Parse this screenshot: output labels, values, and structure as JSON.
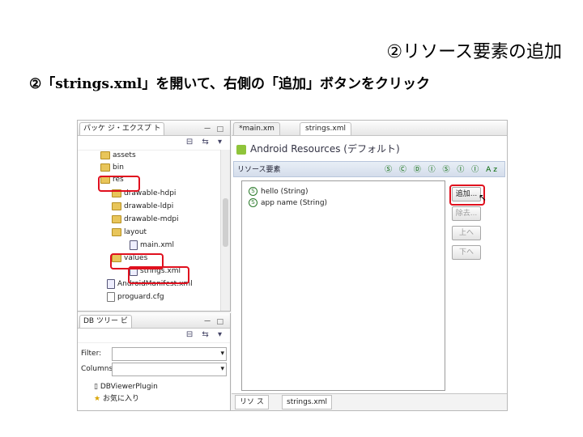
{
  "slide": {
    "title": "②リソース要素の追加",
    "subtitle": "②「strings.xml」を開いて、右側の「追加」ボタンをクリック"
  },
  "package_explorer": {
    "tab_label": "パッケ ジ・エクスプ ト",
    "window_controls": "ー □",
    "tools": "⊟ ⇆ ▾",
    "items": [
      {
        "label": "assets",
        "icon": "folder-icon"
      },
      {
        "label": "bin",
        "icon": "folder-icon"
      },
      {
        "label": "res",
        "icon": "folder-icon"
      },
      {
        "label": "drawable-hdpi",
        "icon": "folder-icon"
      },
      {
        "label": "drawable-ldpi",
        "icon": "folder-icon"
      },
      {
        "label": "drawable-mdpi",
        "icon": "folder-icon"
      },
      {
        "label": "layout",
        "icon": "folder-icon"
      },
      {
        "label": "main.xml",
        "icon": "xml-file-icon"
      },
      {
        "label": "values",
        "icon": "folder-icon"
      },
      {
        "label": "strings.xml",
        "icon": "xml-file-icon"
      },
      {
        "label": "AndroidManifest.xml",
        "icon": "xml-file-icon"
      },
      {
        "label": "proguard.cfg",
        "icon": "file-icon"
      }
    ]
  },
  "db_tree": {
    "tab_label": "DB ツリー ビ",
    "filter_label": "Filter:",
    "columns_label": "Columns:",
    "items": [
      {
        "label": "DBViewerPlugin",
        "icon": "db-icon"
      },
      {
        "label": "お気に入り",
        "icon": "star-icon"
      }
    ]
  },
  "editor": {
    "tabs": [
      {
        "label": "*main.xm"
      },
      {
        "label": "strings.xml"
      }
    ],
    "header": "Android Resources (デフォルト)",
    "section_label": "リソース要素",
    "section_icons": "Ⓢ Ⓒ Ⓓ Ⓘ Ⓢ Ⓘ Ⓘ Az",
    "resources": [
      {
        "label": "hello (String)"
      },
      {
        "label": "app name (String)"
      }
    ],
    "buttons": {
      "add": "追加...",
      "remove": "除去...",
      "up": "上へ",
      "down": "下へ"
    },
    "bottom_tabs": [
      {
        "label": "リソ ス"
      },
      {
        "label": "strings.xml"
      }
    ]
  },
  "colors": {
    "highlight": "#e0101e"
  }
}
